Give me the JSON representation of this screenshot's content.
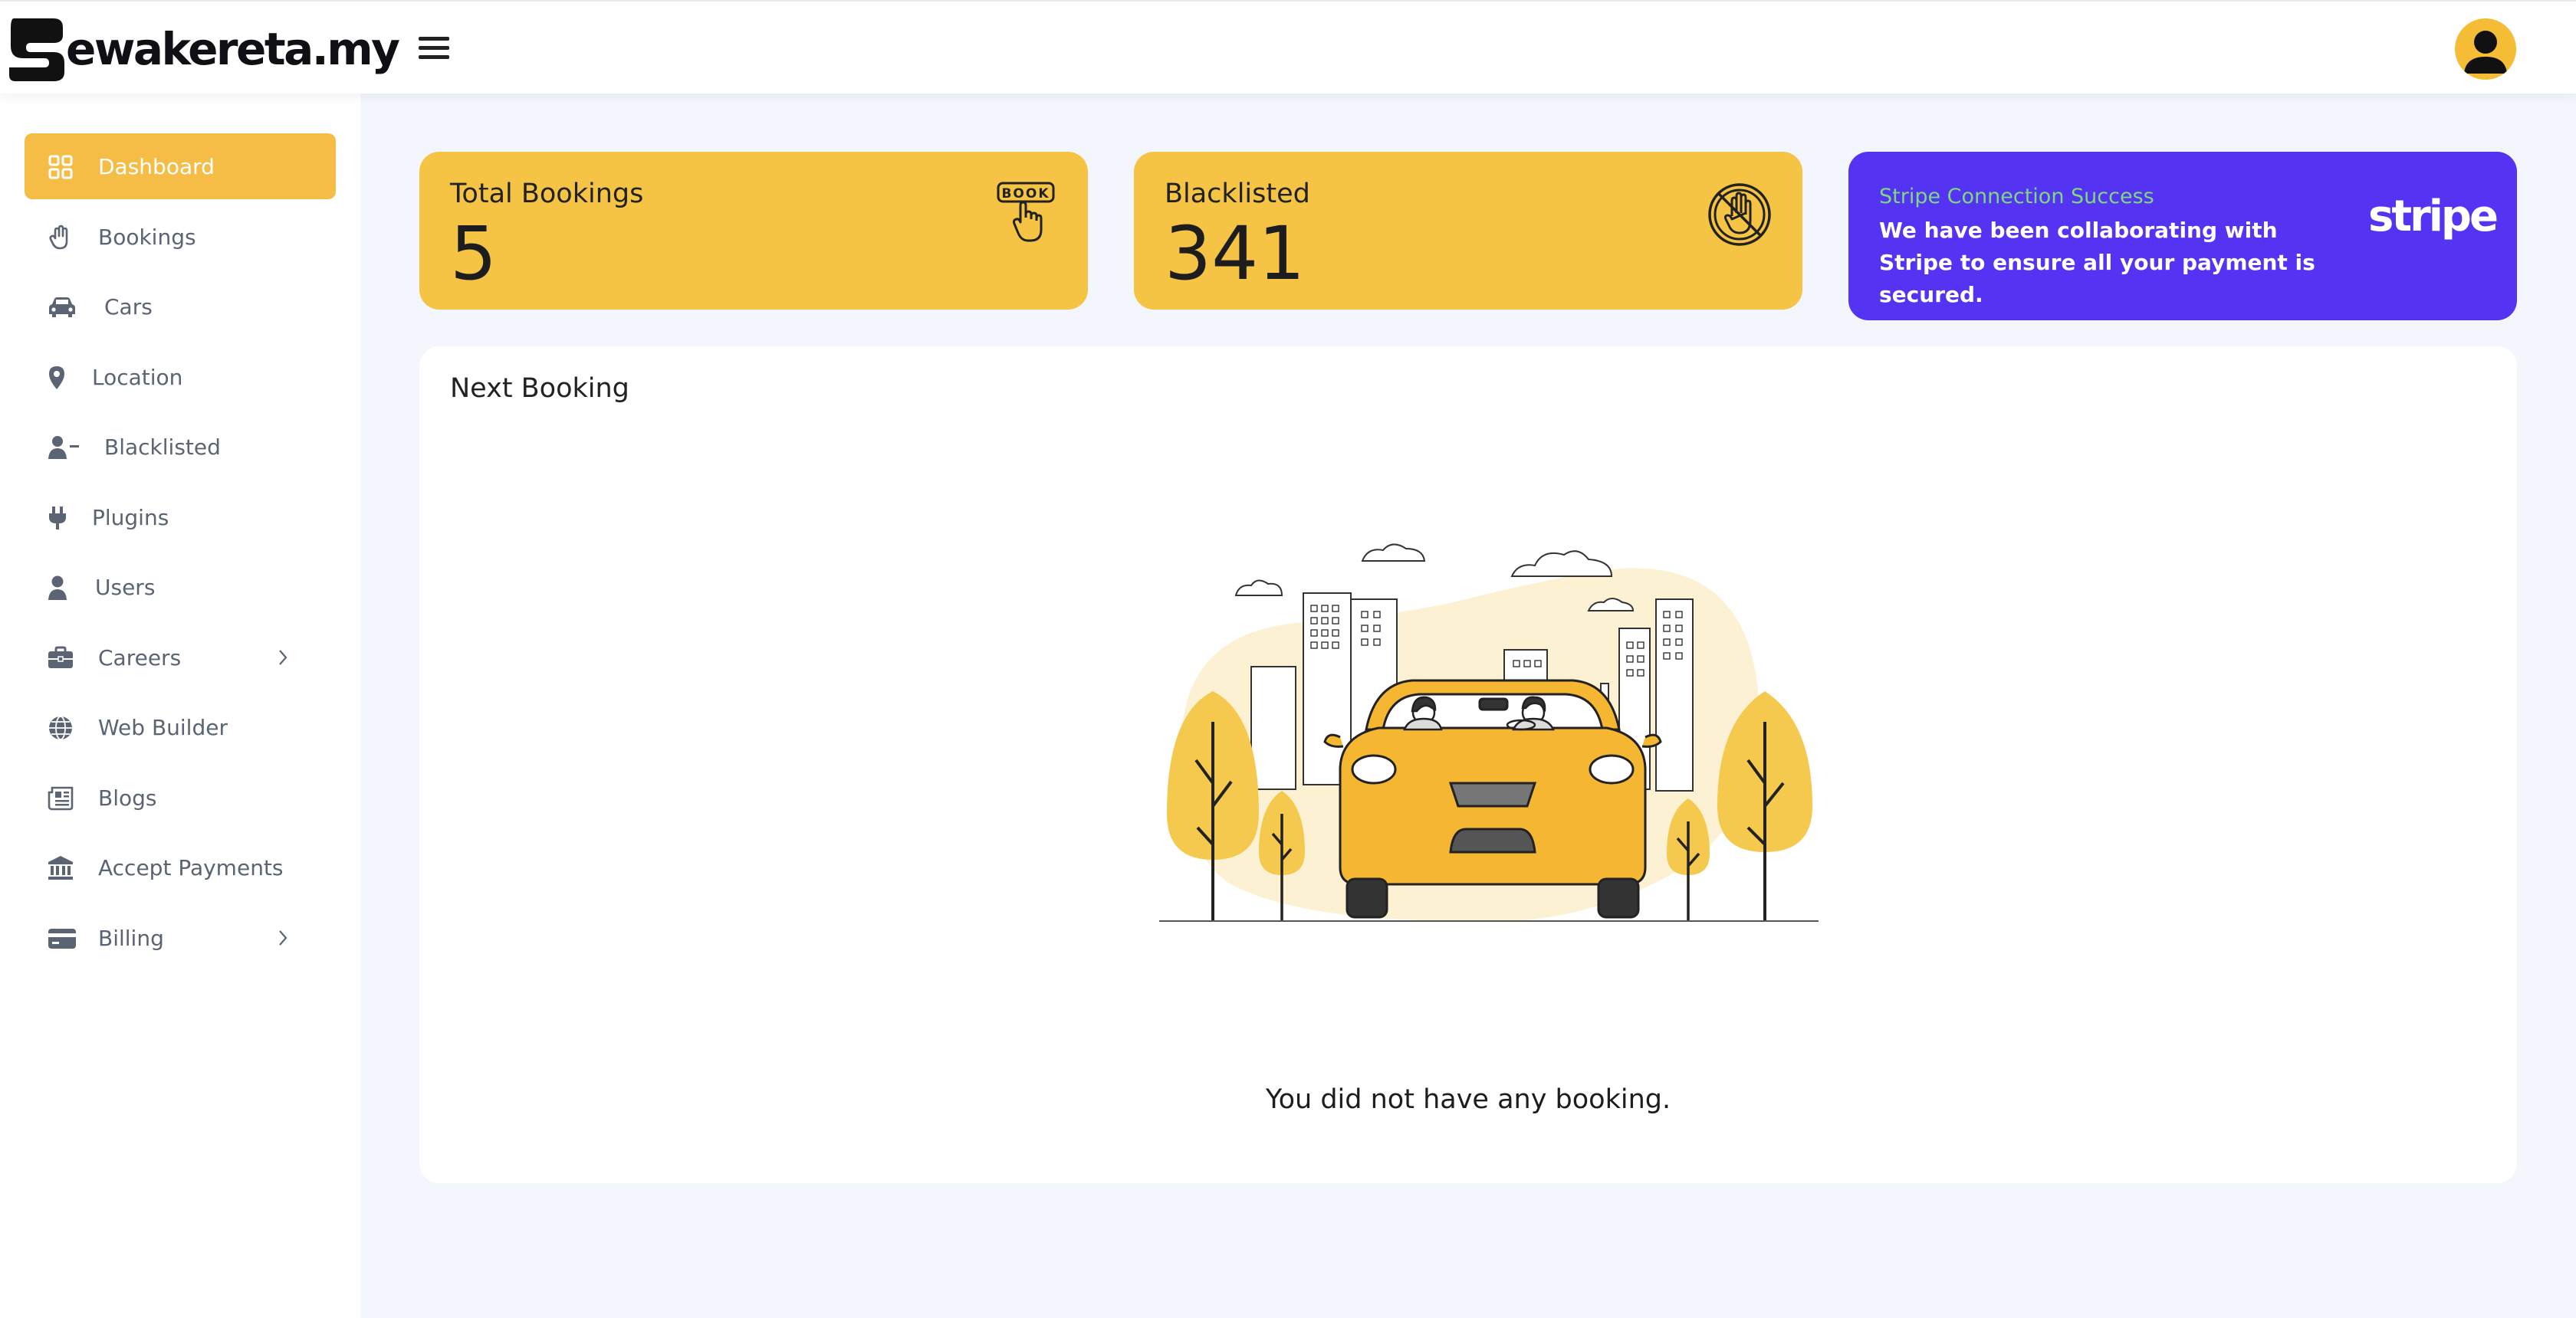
{
  "brand": {
    "name": "ewakereta.my"
  },
  "sidebar": {
    "items": [
      {
        "label": "Dashboard",
        "icon": "dashboard-grid-icon",
        "active": true
      },
      {
        "label": "Bookings",
        "icon": "hand-icon"
      },
      {
        "label": "Cars",
        "icon": "car-icon"
      },
      {
        "label": "Location",
        "icon": "map-pin-icon"
      },
      {
        "label": "Blacklisted",
        "icon": "user-minus-icon"
      },
      {
        "label": "Plugins",
        "icon": "plug-icon"
      },
      {
        "label": "Users",
        "icon": "user-icon"
      },
      {
        "label": "Careers",
        "icon": "briefcase-icon",
        "has_submenu": true
      },
      {
        "label": "Web Builder",
        "icon": "globe-icon"
      },
      {
        "label": "Blogs",
        "icon": "newspaper-icon"
      },
      {
        "label": "Accept Payments",
        "icon": "bank-icon"
      },
      {
        "label": "Billing",
        "icon": "credit-card-icon",
        "has_submenu": true
      }
    ]
  },
  "stats": {
    "total_bookings": {
      "label": "Total Bookings",
      "value": "5",
      "icon_text": "BOOK"
    },
    "blacklisted": {
      "label": "Blacklisted",
      "value": "341"
    }
  },
  "stripe": {
    "title": "Stripe Connection Success",
    "text": "We have been collaborating with Stripe to ensure all your payment is secured.",
    "logo": "stripe"
  },
  "next_booking": {
    "title": "Next Booking",
    "empty_message": "You did not have any booking."
  },
  "colors": {
    "accent": "#f5c445",
    "stripe": "#5433f3",
    "stripe_title": "#7ed87e"
  }
}
